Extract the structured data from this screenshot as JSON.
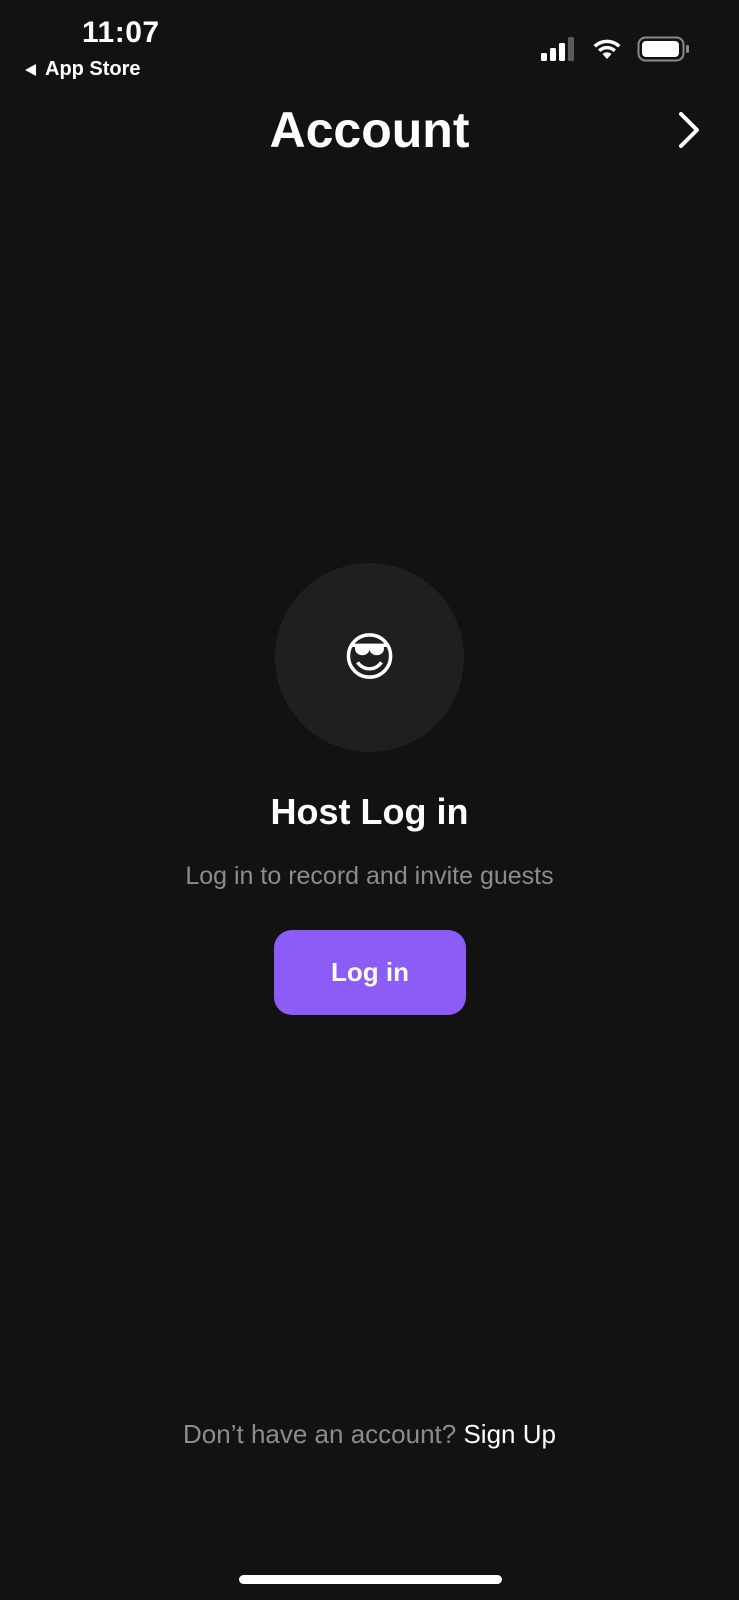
{
  "status_bar": {
    "time": "11:07",
    "back_app": "App Store",
    "icons": [
      "signal-icon",
      "wifi-icon",
      "battery-icon"
    ]
  },
  "header": {
    "title": "Account",
    "next_icon": "chevron-right-icon"
  },
  "main": {
    "avatar_emoji": "😎",
    "title": "Host Log in",
    "subtitle": "Log in to record and invite guests",
    "login_label": "Log in"
  },
  "footer": {
    "prompt": "Don’t have an account?",
    "signup_label": "Sign Up"
  },
  "colors": {
    "background": "#121212",
    "accent": "#8b5cf6",
    "avatar_bg": "#1f1f1f",
    "muted_text": "#8c8c8c"
  }
}
